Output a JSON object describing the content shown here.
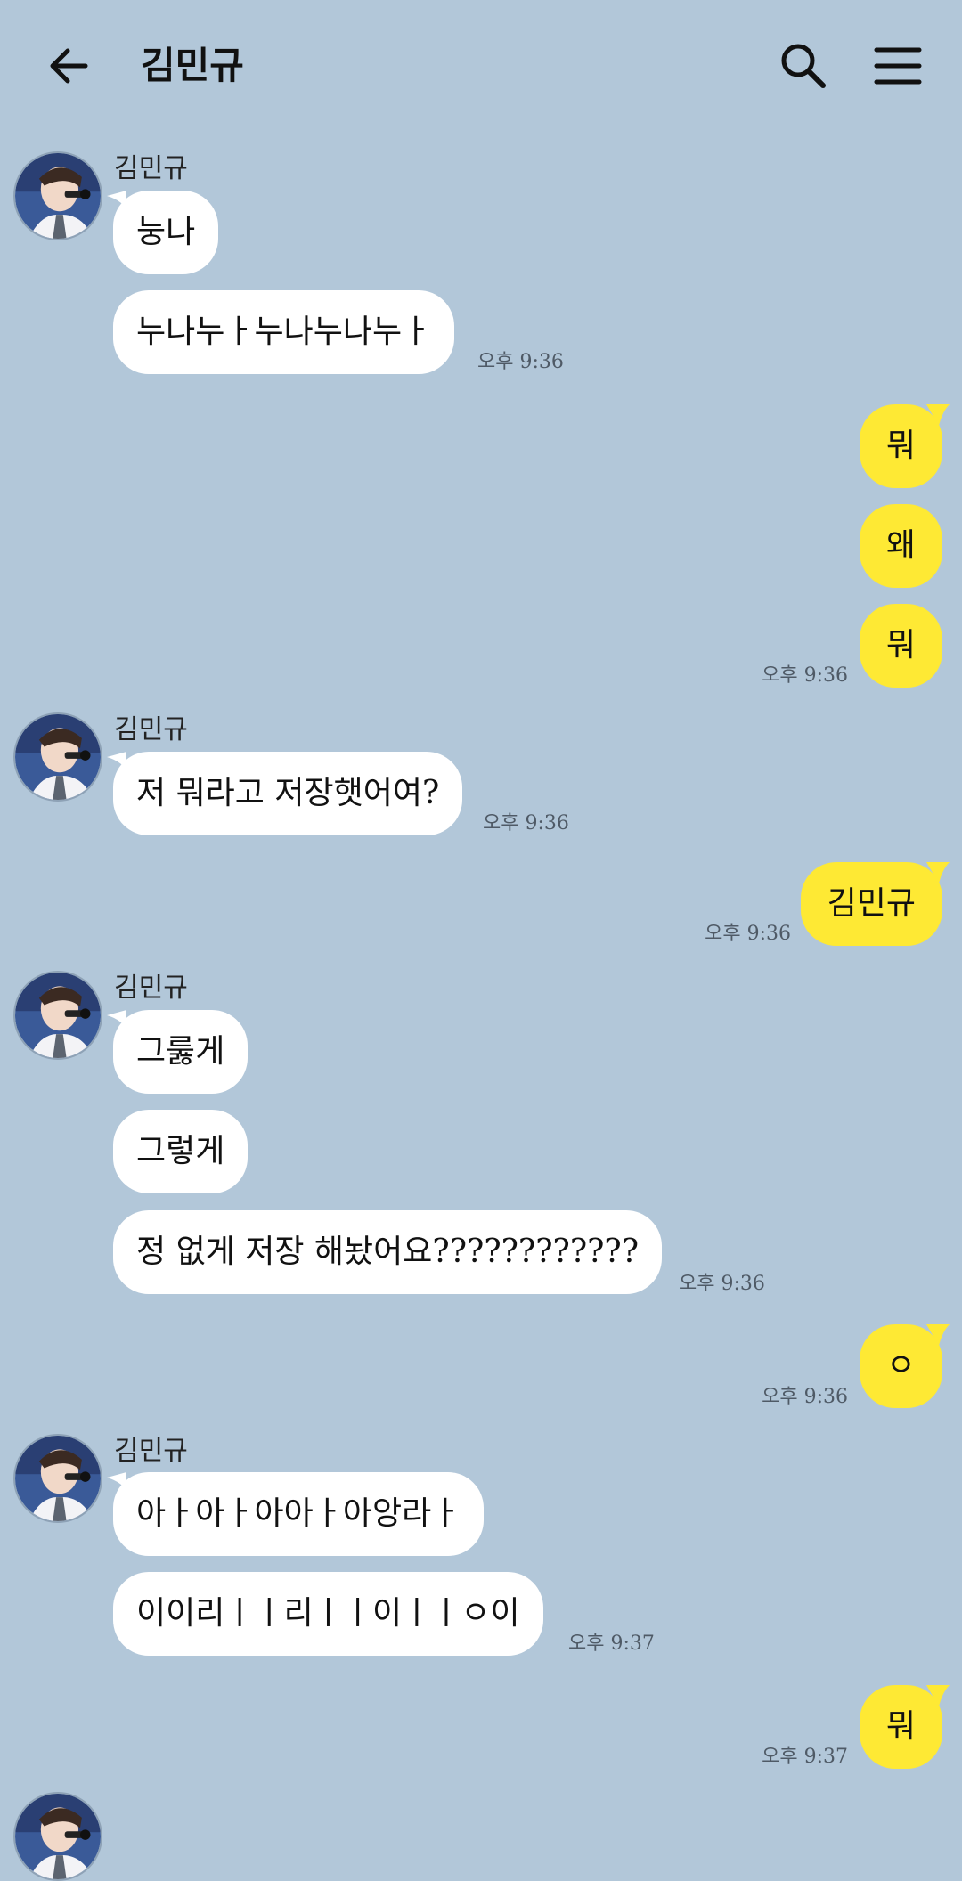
{
  "header": {
    "title": "김민규"
  },
  "icons": {
    "back": "arrow-left-icon",
    "search": "search-icon",
    "menu": "hamburger-menu-icon"
  },
  "colors": {
    "background": "#b2c7d9",
    "incoming_bubble": "#ffffff",
    "outgoing_bubble": "#fee934"
  },
  "messages": [
    {
      "sender": "김민규",
      "text": "눙나"
    },
    {
      "sender": "김민규",
      "text": "누나누ㅏ누나누나누ㅏ",
      "time": "오후 9:36"
    },
    {
      "sender": "me",
      "text": "뭐"
    },
    {
      "sender": "me",
      "text": "왜"
    },
    {
      "sender": "me",
      "text": "뭐",
      "time": "오후 9:36"
    },
    {
      "sender": "김민규",
      "text": "저 뭐라고 저장햇어여?",
      "time": "오후 9:36"
    },
    {
      "sender": "me",
      "text": "김민규",
      "time": "오후 9:36"
    },
    {
      "sender": "김민규",
      "text": "그룷게"
    },
    {
      "sender": "김민규",
      "text": "그렇게"
    },
    {
      "sender": "김민규",
      "text": "정 없게 저장 해놨어요????????????",
      "time": "오후 9:36"
    },
    {
      "sender": "me",
      "text": "ㅇ",
      "time": "오후 9:36"
    },
    {
      "sender": "김민규",
      "text": "아ㅏ아ㅏ아아ㅏ아앙라ㅏ"
    },
    {
      "sender": "김민규",
      "text": "이이리ㅣㅣ리ㅣㅣ이ㅣㅣㅇ이",
      "time": "오후 9:37"
    },
    {
      "sender": "me",
      "text": "뭐",
      "time": "오후 9:37"
    }
  ]
}
